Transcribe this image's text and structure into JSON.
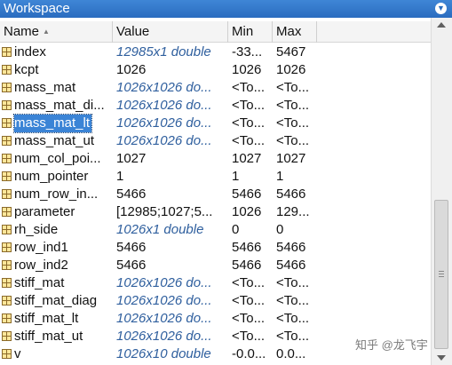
{
  "window": {
    "title": "Workspace"
  },
  "columns": {
    "name": "Name",
    "value": "Value",
    "min": "Min",
    "max": "Max"
  },
  "variables": [
    {
      "name": "index",
      "value": "12985x1 double",
      "min": "-33...",
      "max": "5467",
      "italic": true
    },
    {
      "name": "kcpt",
      "value": "1026",
      "min": "1026",
      "max": "1026",
      "italic": false
    },
    {
      "name": "mass_mat",
      "value": "1026x1026 do...",
      "min": "<To...",
      "max": "<To...",
      "italic": true
    },
    {
      "name": "mass_mat_di...",
      "value": "1026x1026 do...",
      "min": "<To...",
      "max": "<To...",
      "italic": true
    },
    {
      "name": "mass_mat_lt",
      "value": "1026x1026 do...",
      "min": "<To...",
      "max": "<To...",
      "italic": true,
      "selected": true
    },
    {
      "name": "mass_mat_ut",
      "value": "1026x1026 do...",
      "min": "<To...",
      "max": "<To...",
      "italic": true
    },
    {
      "name": "num_col_poi...",
      "value": "1027",
      "min": "1027",
      "max": "1027",
      "italic": false
    },
    {
      "name": "num_pointer",
      "value": "1",
      "min": "1",
      "max": "1",
      "italic": false
    },
    {
      "name": "num_row_in...",
      "value": "5466",
      "min": "5466",
      "max": "5466",
      "italic": false
    },
    {
      "name": "parameter",
      "value": "[12985;1027;5...",
      "min": "1026",
      "max": "129...",
      "italic": false
    },
    {
      "name": "rh_side",
      "value": "1026x1 double",
      "min": "0",
      "max": "0",
      "italic": true
    },
    {
      "name": "row_ind1",
      "value": "5466",
      "min": "5466",
      "max": "5466",
      "italic": false
    },
    {
      "name": "row_ind2",
      "value": "5466",
      "min": "5466",
      "max": "5466",
      "italic": false
    },
    {
      "name": "stiff_mat",
      "value": "1026x1026 do...",
      "min": "<To...",
      "max": "<To...",
      "italic": true
    },
    {
      "name": "stiff_mat_diag",
      "value": "1026x1026 do...",
      "min": "<To...",
      "max": "<To...",
      "italic": true
    },
    {
      "name": "stiff_mat_lt",
      "value": "1026x1026 do...",
      "min": "<To...",
      "max": "<To...",
      "italic": true
    },
    {
      "name": "stiff_mat_ut",
      "value": "1026x1026 do...",
      "min": "<To...",
      "max": "<To...",
      "italic": true
    },
    {
      "name": "v",
      "value": "1026x10 double",
      "min": "-0.0...",
      "max": "0.0...",
      "italic": true
    }
  ],
  "watermark": "知乎 @龙飞宇",
  "icons": {
    "variable": "matrix-grid-icon",
    "menu": "chevron-down-icon",
    "sort": "sort-ascending-icon"
  }
}
